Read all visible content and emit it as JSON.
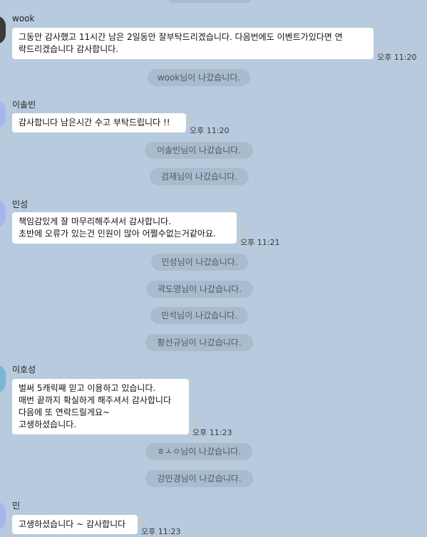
{
  "messages": [
    {
      "sender": "wook",
      "lines": [
        "그동안 감사했고 11시간 남은 2일동안 잘부탁드리겠습니다. 다음번에도 이벤트가있다면 연",
        "락드리겠습니다 감사합니다."
      ],
      "time": "오후 11:20"
    },
    {
      "sender": "이솔빈",
      "lines": [
        "감사합니다 남은시간 수고 부탁드립니다 !!"
      ],
      "time": "오후 11:20"
    },
    {
      "sender": "민성",
      "lines": [
        "책임감있게 잘 마무리해주셔서 감사합니다.",
        "초반에 오류가 있는건 인원이 많아 어쩔수없는거같아요."
      ],
      "time": "오후 11:21"
    },
    {
      "sender": "이호성",
      "lines": [
        "벌써 5캐릭째 믿고 이용하고 있습니다.",
        "매번 끝까지 확실하게 해주셔서 감사합니다",
        "다음에 또 연락드릴게요~",
        "고생하셨습니다."
      ],
      "time": "오후 11:23"
    },
    {
      "sender": "민",
      "lines": [
        "고생하셨습니다 ~ 감사합니다"
      ],
      "time": "오후 11:23"
    }
  ],
  "system_notices": [
    "wook님이 나갔습니다.",
    "이솔빈님이 나갔습니다.",
    "검재님이 나갔습니다.",
    "민성님이 나갔습니다.",
    "곽도영님이 나갔습니다.",
    "민석님이 나갔습니다.",
    "황선규님이 나갔습니다.",
    "ㅎㅅㅇ님이 나갔습니다.",
    "강민경님이 나갔습니다."
  ],
  "colors": {
    "background": "#b8cadd",
    "bubble": "#ffffff",
    "notice_pill": "#a9bbcd",
    "notice_text": "#505a66",
    "read_tick": "#e8c25b"
  }
}
